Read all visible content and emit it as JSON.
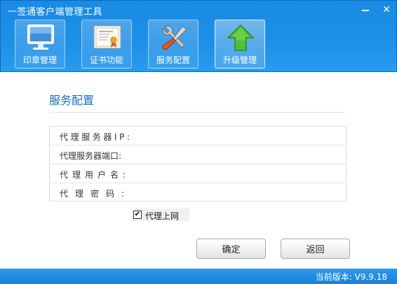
{
  "window": {
    "title": "一签通客户端管理工具"
  },
  "toolbar": {
    "items": [
      {
        "label": "印章管理",
        "icon": "monitor-icon"
      },
      {
        "label": "证书功能",
        "icon": "certificate-icon"
      },
      {
        "label": "服务配置",
        "icon": "tools-icon"
      },
      {
        "label": "升级管理",
        "icon": "upgrade-arrow-icon"
      }
    ]
  },
  "content": {
    "title": "服务配置",
    "fields": [
      {
        "label": "代理服务器IP:",
        "value": ""
      },
      {
        "label": "代理服务器端口:",
        "value": ""
      },
      {
        "label": "代理用户名:",
        "value": ""
      },
      {
        "label": "代理密码:",
        "value": ""
      }
    ],
    "checkbox": {
      "label": "代理上网",
      "checked": true
    }
  },
  "buttons": {
    "ok": "确定",
    "back": "返回"
  },
  "footer": {
    "version": "当前版本: V9.9.18"
  },
  "colors": {
    "header": "#1d8fe6",
    "accent_title": "#1c6fb8",
    "footer": "#2289dd",
    "upgrade_green": "#46b32d"
  }
}
